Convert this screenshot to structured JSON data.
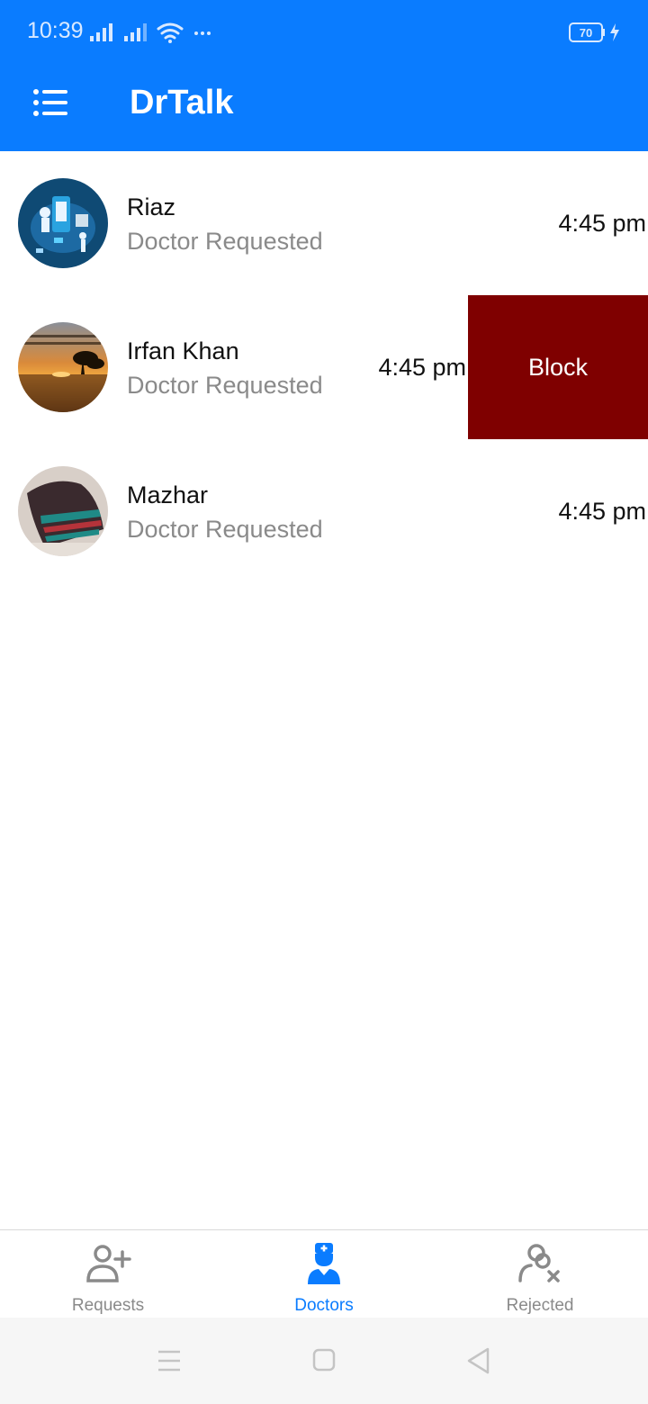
{
  "status_bar": {
    "time": "10:39",
    "battery": "70",
    "icons": [
      "signal-icon",
      "signal-icon",
      "wifi-icon",
      "more-dots-icon",
      "battery-icon",
      "charging-icon"
    ]
  },
  "app_bar": {
    "title": "DrTalk",
    "menu_icon": "menu-icon"
  },
  "requests": [
    {
      "name": "Riaz",
      "subtitle": "Doctor Requested",
      "time": "4:45 pm"
    },
    {
      "name": "Irfan Khan",
      "subtitle": "Doctor Requested",
      "time": "4:45 pm",
      "swipe_action": "Block"
    },
    {
      "name": "Mazhar",
      "subtitle": "Doctor Requested",
      "time": "4:45 pm"
    }
  ],
  "bottom_nav": {
    "items": [
      {
        "label": "Requests",
        "icon": "person-add-icon",
        "active": false
      },
      {
        "label": "Doctors",
        "icon": "doctor-icon",
        "active": true
      },
      {
        "label": "Rejected",
        "icon": "person-remove-icon",
        "active": false
      }
    ]
  },
  "system_nav": {
    "icons": [
      "recents-icon",
      "home-icon",
      "back-icon"
    ]
  },
  "colors": {
    "primary": "#0a7cff",
    "block_action": "#7f0000",
    "subtitle_text": "#8a8a8a",
    "active_tab": "#0a7cff",
    "inactive_tab": "#8a8a8a"
  }
}
